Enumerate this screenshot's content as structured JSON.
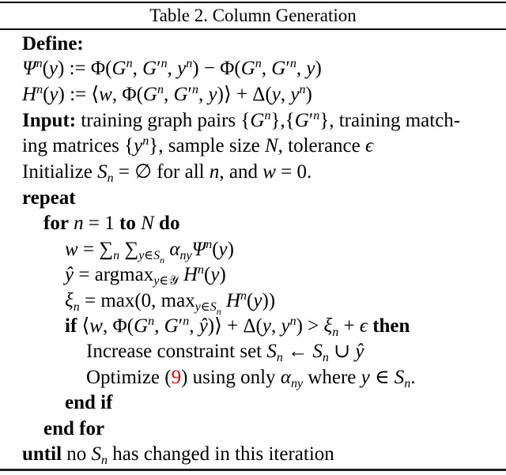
{
  "caption": "Table 2. Column Generation",
  "algorithm": {
    "define_label": "Define:",
    "psi_def": "Ψⁿ(y) := Φ(Gⁿ, G′ⁿ, yⁿ) − Φ(Gⁿ, G′ⁿ, y)",
    "h_def": "Hⁿ(y) := ⟨w, Φ(Gⁿ, G′ⁿ, y)⟩ + Δ(y, yⁿ)",
    "input_label": "Input:",
    "input_text_1": "training graph pairs {Gⁿ},{G′ⁿ}, training match-",
    "input_text_2": "ing matrices {yⁿ}, sample size N, tolerance ϵ",
    "initialize": "Initialize Sₙ = ∅ for all n, and w = 0.",
    "repeat_label": "repeat",
    "for_kw": "for",
    "for_expr": "n = 1",
    "to_kw": "to",
    "for_N": "N",
    "do_kw": "do",
    "w_update": "w = Σₙ Σ_{y∈Sₙ} α_ny Ψⁿ(y)",
    "yhat_update": "ŷ = argmax_{y∈𝒴} Hⁿ(y)",
    "xi_update": "ξₙ = max(0, max_{y∈Sₙ} Hⁿ(y))",
    "if_kw": "if",
    "if_cond": "⟨w, Φ(Gⁿ, G′ⁿ, ŷ)⟩ + Δ(y, yⁿ) > ξₙ + ϵ",
    "then_kw": "then",
    "increase_text": "Increase constraint set Sₙ ← Sₙ ∪ ŷ",
    "optimize_pre": "Optimize (",
    "optimize_ref": "9",
    "optimize_post": ") using only α_ny where y ∈ Sₙ.",
    "end_if": "end if",
    "end_for": "end for",
    "until_kw": "until",
    "until_text": "no Sₙ has changed in this iteration"
  },
  "colors": {
    "reference_link": "#e8000b"
  }
}
